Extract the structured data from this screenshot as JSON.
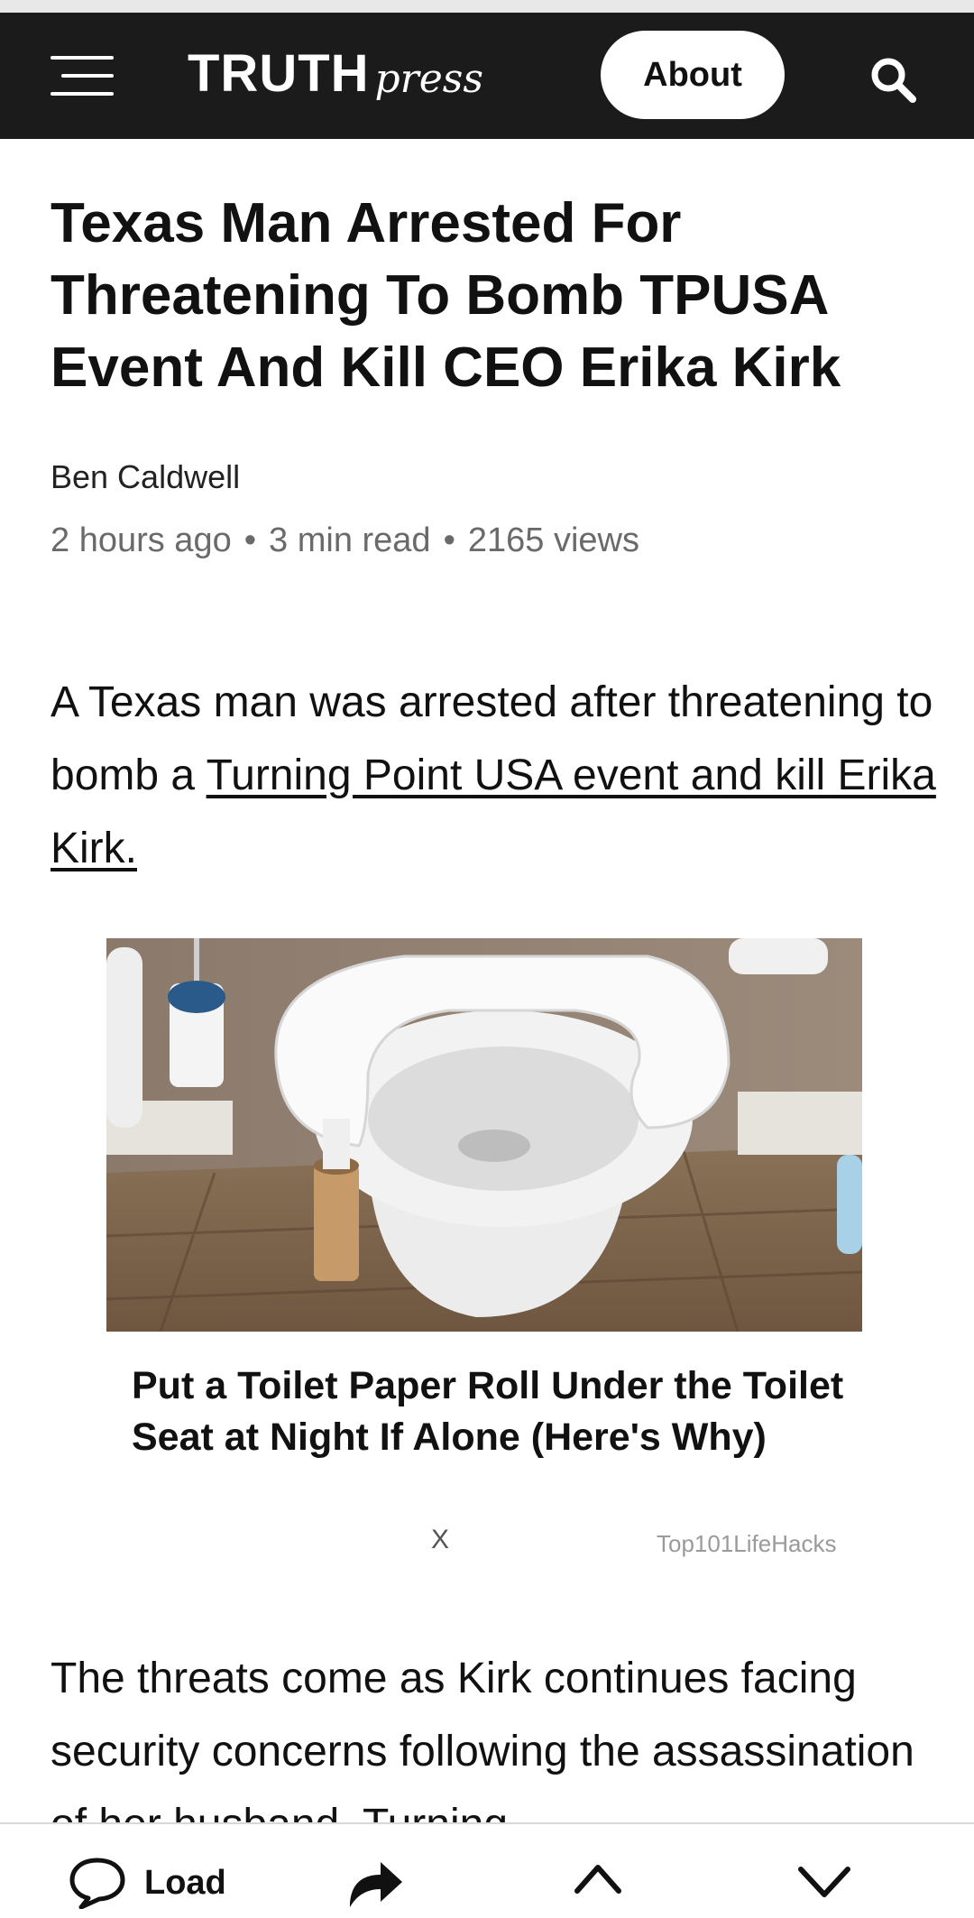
{
  "header": {
    "menu_icon": "hamburger-menu-icon",
    "logo_main": "TRUTH",
    "logo_script": "press",
    "about_label": "About",
    "search_icon": "search-icon"
  },
  "article": {
    "headline": "Texas Man Arrested For Threatening To Bomb TPUSA Event And Kill CEO Erika Kirk",
    "author": "Ben Caldwell",
    "time_ago": "2 hours ago",
    "read_time": "3 min read",
    "views": "2165 views",
    "meta_separator": "•",
    "para1_text": "A Texas man was arrested after threatening to bomb a ",
    "para1_link": "Turning Point USA event and kill Erika Kirk.",
    "para2_text": "The threats come as Kirk continues facing security concerns following the assassination of her husband. Turning"
  },
  "ad": {
    "title": "Put a Toilet Paper Roll Under the Toilet Seat at Night If Alone (Here's Why)",
    "close_label": "X",
    "source": "Top101LifeHacks"
  },
  "bottom_bar": {
    "load_label": "Load",
    "comment_icon": "comment-bubble-icon",
    "share_icon": "share-arrow-icon",
    "up_icon": "chevron-up-icon",
    "down_icon": "chevron-down-icon"
  },
  "colors": {
    "header_bg": "#1b1b1b",
    "text": "#111111",
    "meta_text": "#6a6a6a",
    "ad_source_text": "#9a9a9a"
  }
}
